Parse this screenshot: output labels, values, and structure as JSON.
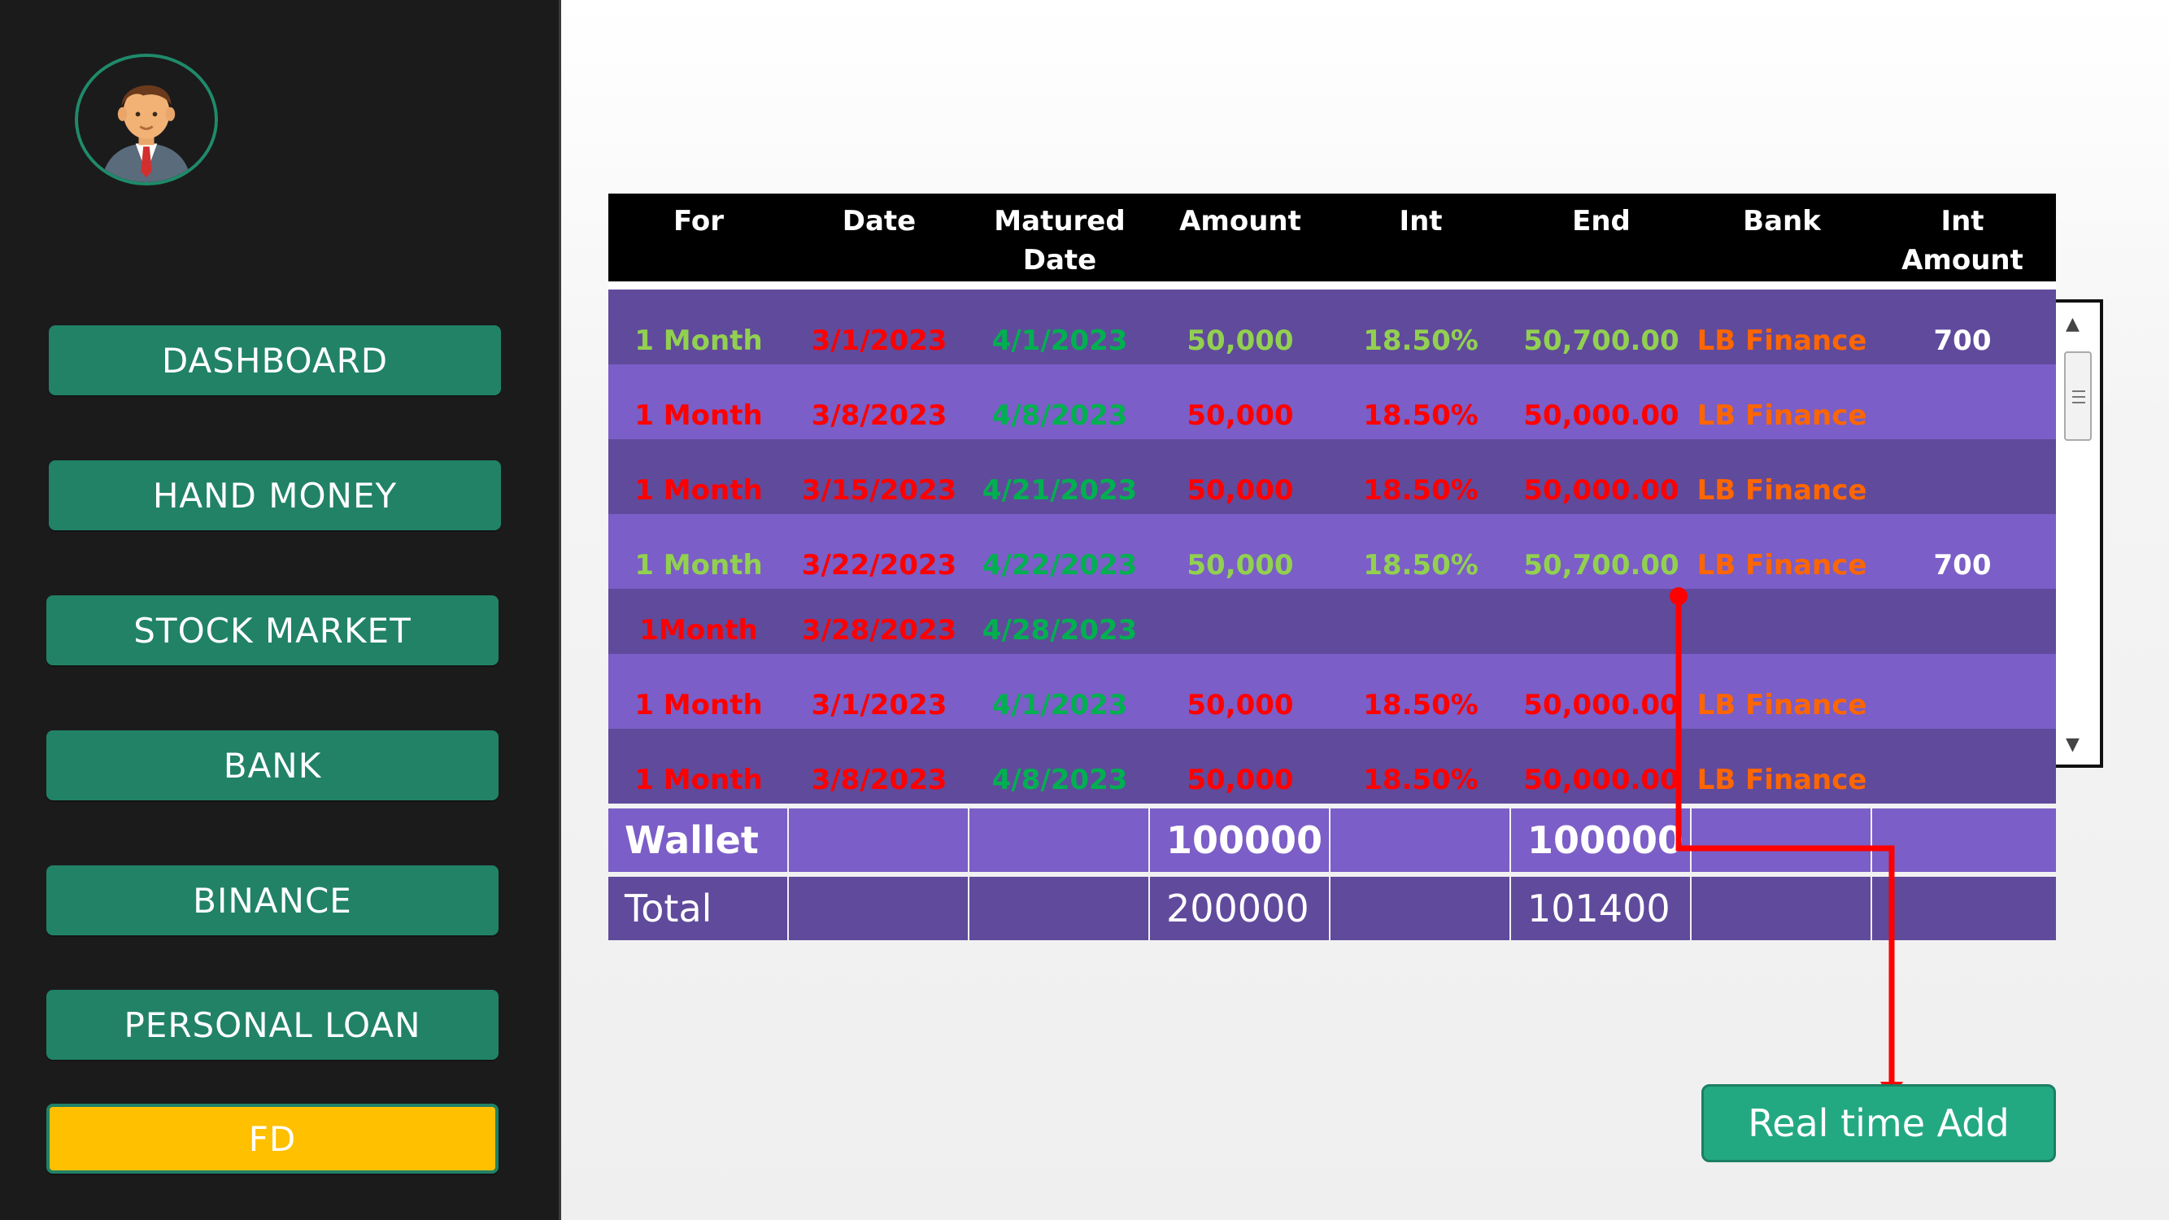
{
  "sidebar": {
    "items": [
      {
        "label": "DASHBOARD"
      },
      {
        "label": "HAND MONEY"
      },
      {
        "label": "STOCK MARKET"
      },
      {
        "label": "BANK"
      },
      {
        "label": "BINANCE"
      },
      {
        "label": "PERSONAL LOAN"
      },
      {
        "label": "FD",
        "active": true
      }
    ]
  },
  "table": {
    "headers": [
      "For",
      "Date",
      "Matured\nDate",
      "Amount",
      "Int",
      "End",
      "Bank",
      "Int\nAmount"
    ],
    "rows": [
      {
        "cells": [
          {
            "text": "1 Month",
            "color": "#92d050"
          },
          {
            "text": "3/1/2023",
            "color": "#ff0000"
          },
          {
            "text": "4/1/2023",
            "color": "#00b050"
          },
          {
            "text": "50,000",
            "color": "#92d050"
          },
          {
            "text": "18.50%",
            "color": "#92d050"
          },
          {
            "text": "50,700.00",
            "color": "#92d050"
          },
          {
            "text": "LB Finance",
            "color": "#ff6600"
          },
          {
            "text": "700",
            "color": "#ffffff"
          }
        ]
      },
      {
        "cells": [
          {
            "text": "1 Month",
            "color": "#ff0000"
          },
          {
            "text": "3/8/2023",
            "color": "#ff0000"
          },
          {
            "text": "4/8/2023",
            "color": "#00b050"
          },
          {
            "text": "50,000",
            "color": "#ff0000"
          },
          {
            "text": "18.50%",
            "color": "#ff0000"
          },
          {
            "text": "50,000.00",
            "color": "#ff0000"
          },
          {
            "text": "LB Finance",
            "color": "#ff6600"
          },
          {
            "text": "",
            "color": "#ffffff"
          }
        ]
      },
      {
        "cells": [
          {
            "text": "1 Month",
            "color": "#ff0000"
          },
          {
            "text": "3/15/2023",
            "color": "#ff0000"
          },
          {
            "text": "4/21/2023",
            "color": "#00b050"
          },
          {
            "text": "50,000",
            "color": "#ff0000"
          },
          {
            "text": "18.50%",
            "color": "#ff0000"
          },
          {
            "text": "50,000.00",
            "color": "#ff0000"
          },
          {
            "text": "LB Finance",
            "color": "#ff6600"
          },
          {
            "text": "",
            "color": "#ffffff"
          }
        ]
      },
      {
        "cells": [
          {
            "text": "1 Month",
            "color": "#92d050"
          },
          {
            "text": "3/22/2023",
            "color": "#ff0000"
          },
          {
            "text": "4/22/2023",
            "color": "#00b050"
          },
          {
            "text": "50,000",
            "color": "#92d050"
          },
          {
            "text": "18.50%",
            "color": "#92d050"
          },
          {
            "text": "50,700.00",
            "color": "#92d050"
          },
          {
            "text": "LB Finance",
            "color": "#ff6600"
          },
          {
            "text": "700",
            "color": "#ffffff"
          }
        ]
      },
      {
        "cells": [
          {
            "text": "1Month",
            "color": "#ff0000"
          },
          {
            "text": "3/28/2023",
            "color": "#ff0000"
          },
          {
            "text": "4/28/2023",
            "color": "#00b050"
          },
          {
            "text": "",
            "color": "#ff0000"
          },
          {
            "text": "",
            "color": "#ff0000"
          },
          {
            "text": "",
            "color": "#ff0000"
          },
          {
            "text": "",
            "color": "#ff6600"
          },
          {
            "text": "",
            "color": "#ffffff"
          }
        ]
      },
      {
        "cells": [
          {
            "text": "1 Month",
            "color": "#ff0000"
          },
          {
            "text": "3/1/2023",
            "color": "#ff0000"
          },
          {
            "text": "4/1/2023",
            "color": "#00b050"
          },
          {
            "text": "50,000",
            "color": "#ff0000"
          },
          {
            "text": "18.50%",
            "color": "#ff0000"
          },
          {
            "text": "50,000.00",
            "color": "#ff0000"
          },
          {
            "text": "LB Finance",
            "color": "#ff6600"
          },
          {
            "text": "",
            "color": "#ffffff"
          }
        ]
      },
      {
        "cells": [
          {
            "text": "1 Month",
            "color": "#ff0000"
          },
          {
            "text": "3/8/2023",
            "color": "#ff0000"
          },
          {
            "text": "4/8/2023",
            "color": "#00b050"
          },
          {
            "text": "50,000",
            "color": "#ff0000"
          },
          {
            "text": "18.50%",
            "color": "#ff0000"
          },
          {
            "text": "50,000.00",
            "color": "#ff0000"
          },
          {
            "text": "LB Finance",
            "color": "#ff6600"
          },
          {
            "text": "",
            "color": "#ffffff"
          }
        ]
      }
    ],
    "wallet": {
      "label": "Wallet",
      "amount": "100000",
      "end": "100000"
    },
    "total": {
      "label": "Total",
      "amount": "200000",
      "end": "101400"
    }
  },
  "realtime_button": {
    "label": "Real time Add"
  },
  "colors": {
    "sidebar_bg": "#1b1b1b",
    "nav_button": "#218266",
    "nav_active": "#ffc000",
    "row_dark": "#604a9c",
    "row_light": "#7b5ec7",
    "connector": "#ff0000",
    "realtime_button": "#23a982"
  }
}
